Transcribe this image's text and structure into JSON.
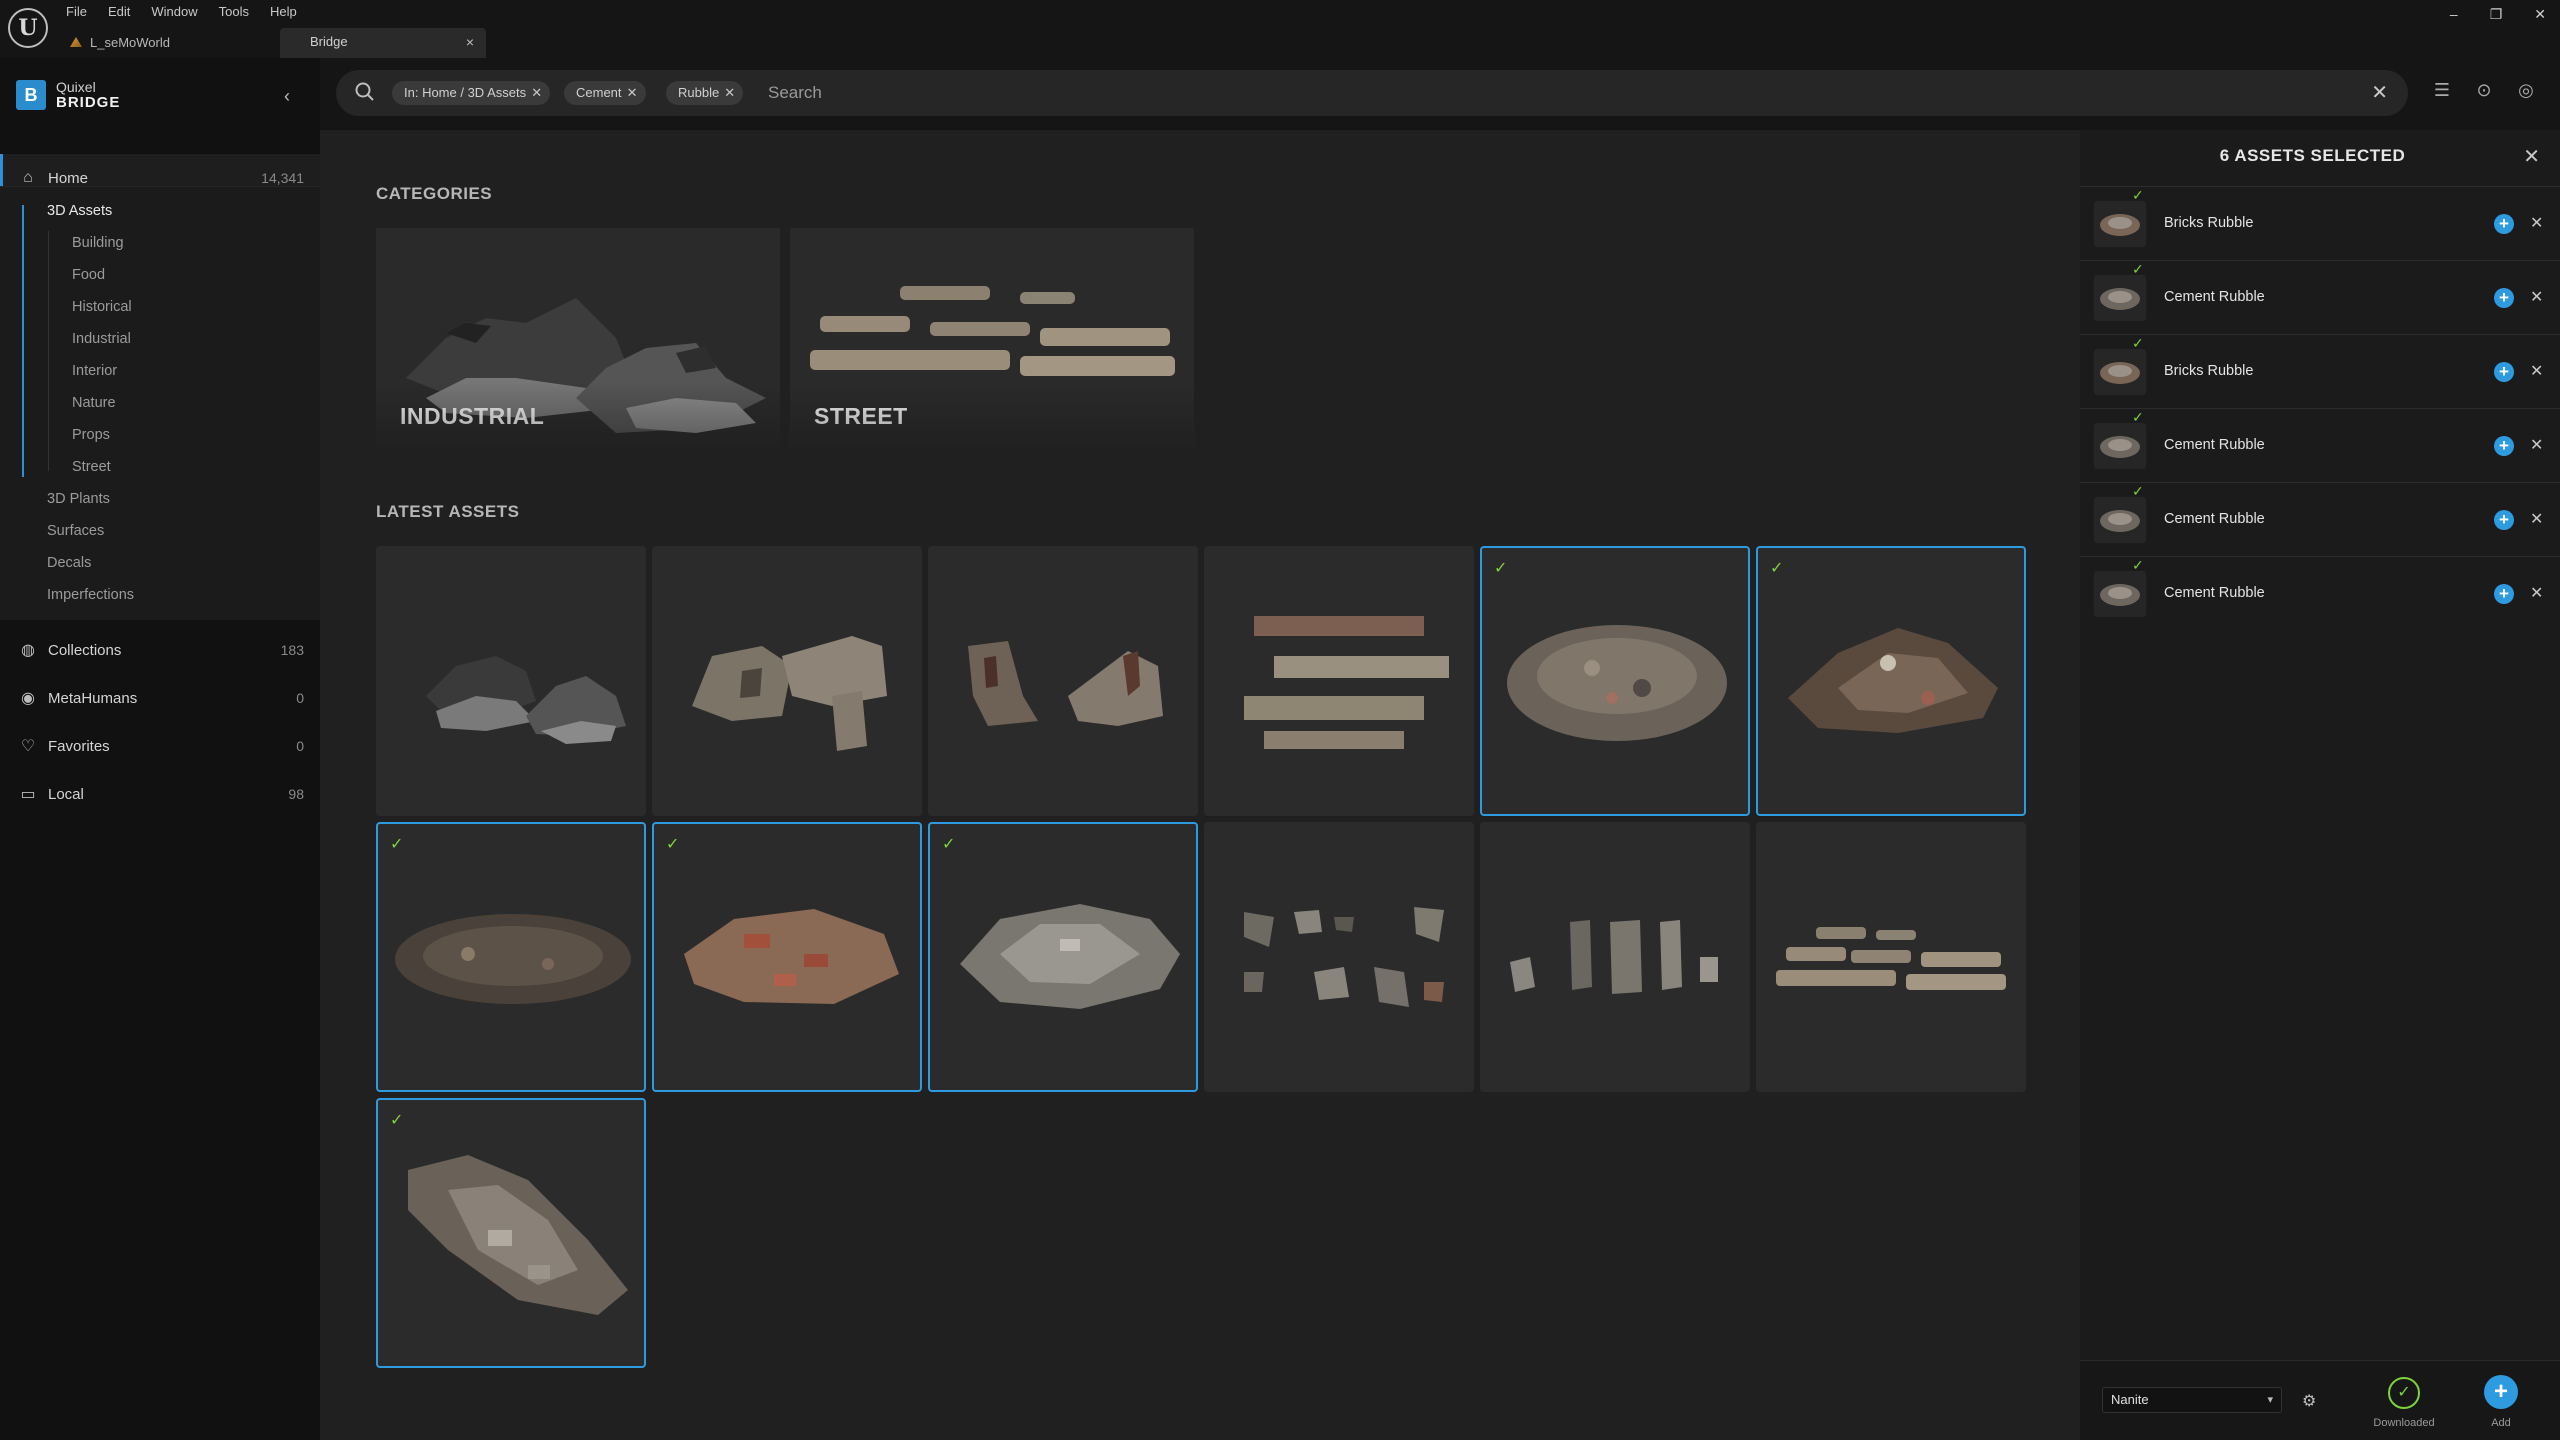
{
  "titlebar": {
    "menu": [
      "File",
      "Edit",
      "Window",
      "Tools",
      "Help"
    ],
    "world_tab": "L_seMoWorld",
    "bridge_tab": "Bridge"
  },
  "brand": {
    "line1": "Quixel",
    "line2": "BRIDGE"
  },
  "sidebar": {
    "home": {
      "label": "Home",
      "count": "14,341"
    },
    "tree": {
      "root": "3D Assets",
      "children": [
        "Building",
        "Food",
        "Historical",
        "Industrial",
        "Interior",
        "Nature",
        "Props",
        "Street"
      ],
      "siblings": [
        "3D Plants",
        "Surfaces",
        "Decals",
        "Imperfections"
      ]
    },
    "bottom": [
      {
        "label": "Collections",
        "count": "183",
        "icon": "globe-icon"
      },
      {
        "label": "MetaHumans",
        "count": "0",
        "icon": "person-icon"
      },
      {
        "label": "Favorites",
        "count": "0",
        "icon": "heart-icon"
      },
      {
        "label": "Local",
        "count": "98",
        "icon": "monitor-icon"
      }
    ]
  },
  "search": {
    "chips": [
      "In: Home / 3D Assets",
      "Cement",
      "Rubble"
    ],
    "placeholder": "Search"
  },
  "main": {
    "categories_title": "CATEGORIES",
    "categories": [
      "INDUSTRIAL",
      "STREET"
    ],
    "latest_title": "LATEST ASSETS",
    "assets": [
      {
        "kind": "rocks",
        "selected": false
      },
      {
        "kind": "ruins",
        "selected": false
      },
      {
        "kind": "walls",
        "selected": false
      },
      {
        "kind": "brick-beams",
        "selected": false
      },
      {
        "kind": "pile-gray",
        "selected": true
      },
      {
        "kind": "pile-brown",
        "selected": true
      },
      {
        "kind": "flat-dark",
        "selected": true
      },
      {
        "kind": "flat-brick",
        "selected": true
      },
      {
        "kind": "flat-gray",
        "selected": true
      },
      {
        "kind": "fragments",
        "selected": false
      },
      {
        "kind": "pillars",
        "selected": false
      },
      {
        "kind": "curbs",
        "selected": false
      },
      {
        "kind": "long-pile",
        "selected": true
      }
    ]
  },
  "selection_panel": {
    "title": "6 ASSETS SELECTED",
    "items": [
      "Bricks Rubble",
      "Cement Rubble",
      "Bricks Rubble",
      "Cement Rubble",
      "Cement Rubble",
      "Cement Rubble"
    ],
    "quality": "Nanite",
    "downloaded_label": "Downloaded",
    "add_label": "Add"
  },
  "colors": {
    "accent": "#2e9be0",
    "check": "#7dd33a",
    "background": "#202020"
  }
}
